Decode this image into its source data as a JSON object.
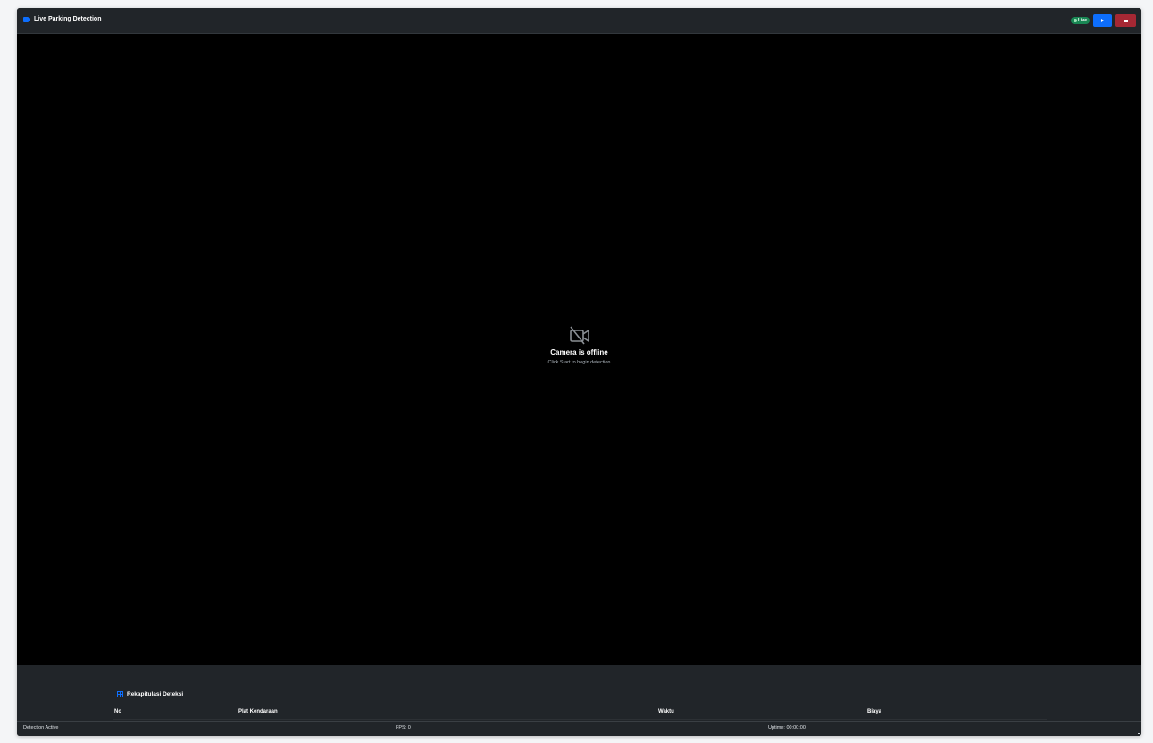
{
  "header": {
    "title": "Live Parking Detection",
    "icon": "video-camera-icon",
    "live_label": "Live",
    "start_icon": "play-icon",
    "stop_icon": "stop-icon"
  },
  "video": {
    "offline_icon": "camera-off-icon",
    "offline_title": "Camera is offline",
    "offline_subtitle": "Click Start to begin detection"
  },
  "recap": {
    "icon": "table-icon",
    "title": "Rekapitulasi Deteksi",
    "columns": [
      "No",
      "Plat Kendaraan",
      "Waktu",
      "Biaya"
    ]
  },
  "status": {
    "detection": "Detection Active",
    "fps": "FPS: 0",
    "uptime": "Uptime: 00:00:00"
  },
  "colors": {
    "primary": "#0d6efd",
    "success": "#198754",
    "danger": "#a52834",
    "panel": "#212529",
    "video_bg": "#000000"
  }
}
